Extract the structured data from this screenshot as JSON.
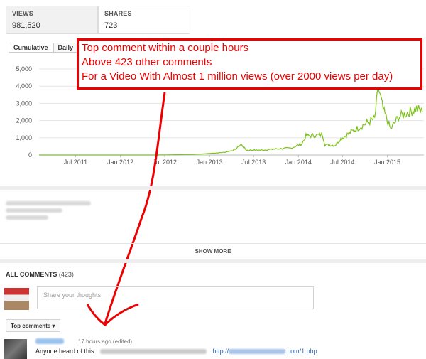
{
  "stats": {
    "views_label": "VIEWS",
    "views_value": "981,520",
    "shares_label": "SHARES",
    "shares_value": "723"
  },
  "chart_toggles": {
    "cumulative": "Cumulative",
    "daily": "Daily"
  },
  "annotation": {
    "line1": "Top comment within a couple hours",
    "line2": "Above 423 other comments",
    "line3": "For a Video With Almost 1 million views (over 2000 views per day)",
    "color": "#e00000"
  },
  "chart_data": {
    "type": "line",
    "title": "",
    "ylim": [
      0,
      5000
    ],
    "yticks": [
      "0",
      "1,000",
      "2,000",
      "3,000",
      "4,000",
      "5,000"
    ],
    "ytick_values": [
      0,
      1000,
      2000,
      3000,
      4000,
      5000
    ],
    "xticks": [
      "Jul 2011",
      "Jan 2012",
      "Jul 2012",
      "Jan 2013",
      "Jul 2013",
      "Jan 2014",
      "Jul 2014",
      "Jan 2015"
    ],
    "x_range": [
      "2011-02-01",
      "2015-05-31"
    ],
    "series": [
      {
        "color": "#7cc21a",
        "points": [
          [
            "2011-02-01",
            0
          ],
          [
            "2012-06-01",
            0
          ],
          [
            "2012-09-01",
            20
          ],
          [
            "2012-12-01",
            60
          ],
          [
            "2013-03-01",
            150
          ],
          [
            "2013-04-15",
            300
          ],
          [
            "2013-05-10",
            620
          ],
          [
            "2013-06-01",
            280
          ],
          [
            "2013-08-01",
            280
          ],
          [
            "2013-10-01",
            350
          ],
          [
            "2013-12-01",
            400
          ],
          [
            "2014-01-15",
            650
          ],
          [
            "2014-02-01",
            1100
          ],
          [
            "2014-03-20",
            1150
          ],
          [
            "2014-04-10",
            1180
          ],
          [
            "2014-04-20",
            600
          ],
          [
            "2014-06-01",
            560
          ],
          [
            "2014-06-20",
            900
          ],
          [
            "2014-08-01",
            1300
          ],
          [
            "2014-10-01",
            1800
          ],
          [
            "2014-11-10",
            2100
          ],
          [
            "2014-11-25",
            3900
          ],
          [
            "2014-12-15",
            2600
          ],
          [
            "2015-01-15",
            1500
          ],
          [
            "2015-02-15",
            2200
          ],
          [
            "2015-04-01",
            2500
          ],
          [
            "2015-05-01",
            2700
          ],
          [
            "2015-05-25",
            2500
          ]
        ]
      }
    ]
  },
  "description": {
    "show_more": "SHOW MORE"
  },
  "comments": {
    "title": "ALL COMMENTS",
    "count": "(423)",
    "share_placeholder": "Share your thoughts",
    "sort_label": "Top comments",
    "first": {
      "time": "17 hours ago (edited)",
      "text": "Anyone heard of this",
      "link_prefix": "http://",
      "link_suffix": ".com/1.php"
    }
  }
}
